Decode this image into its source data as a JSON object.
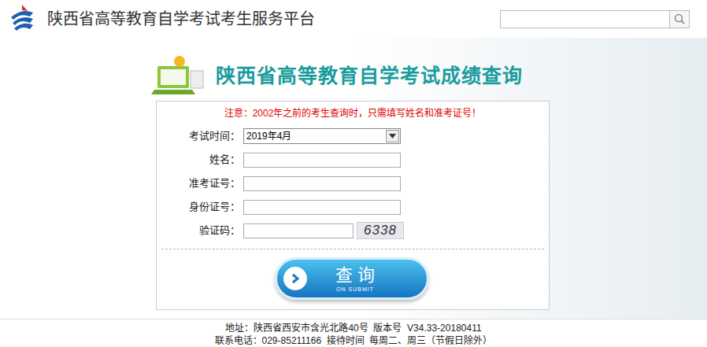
{
  "header": {
    "title": "陕西省高等教育自学考试考生服务平台",
    "search": {
      "value": ""
    }
  },
  "panel": {
    "title": "陕西省高等教育自学考试成绩查询",
    "notice": "注意：2002年之前的考生查询时，只需填写姓名和准考证号！",
    "fields": [
      {
        "label": "考试时间：",
        "kind": "select",
        "value": "2019年4月"
      },
      {
        "label": "姓名：",
        "kind": "text",
        "value": ""
      },
      {
        "label": "准考证号：",
        "kind": "text",
        "value": ""
      },
      {
        "label": "身份证号：",
        "kind": "text",
        "value": ""
      },
      {
        "label": "验证码：",
        "kind": "captcha",
        "value": "",
        "captcha": "6338"
      }
    ],
    "submit": {
      "label": "查 询",
      "sublabel": "ON SUBMIT"
    }
  },
  "footer": {
    "lines": [
      "地址：陕西省西安市含光北路40号  版本号  V34.33-20180411",
      "联系电话：029-85211166  接待时间  每周二、周三（节假日除外）"
    ]
  }
}
